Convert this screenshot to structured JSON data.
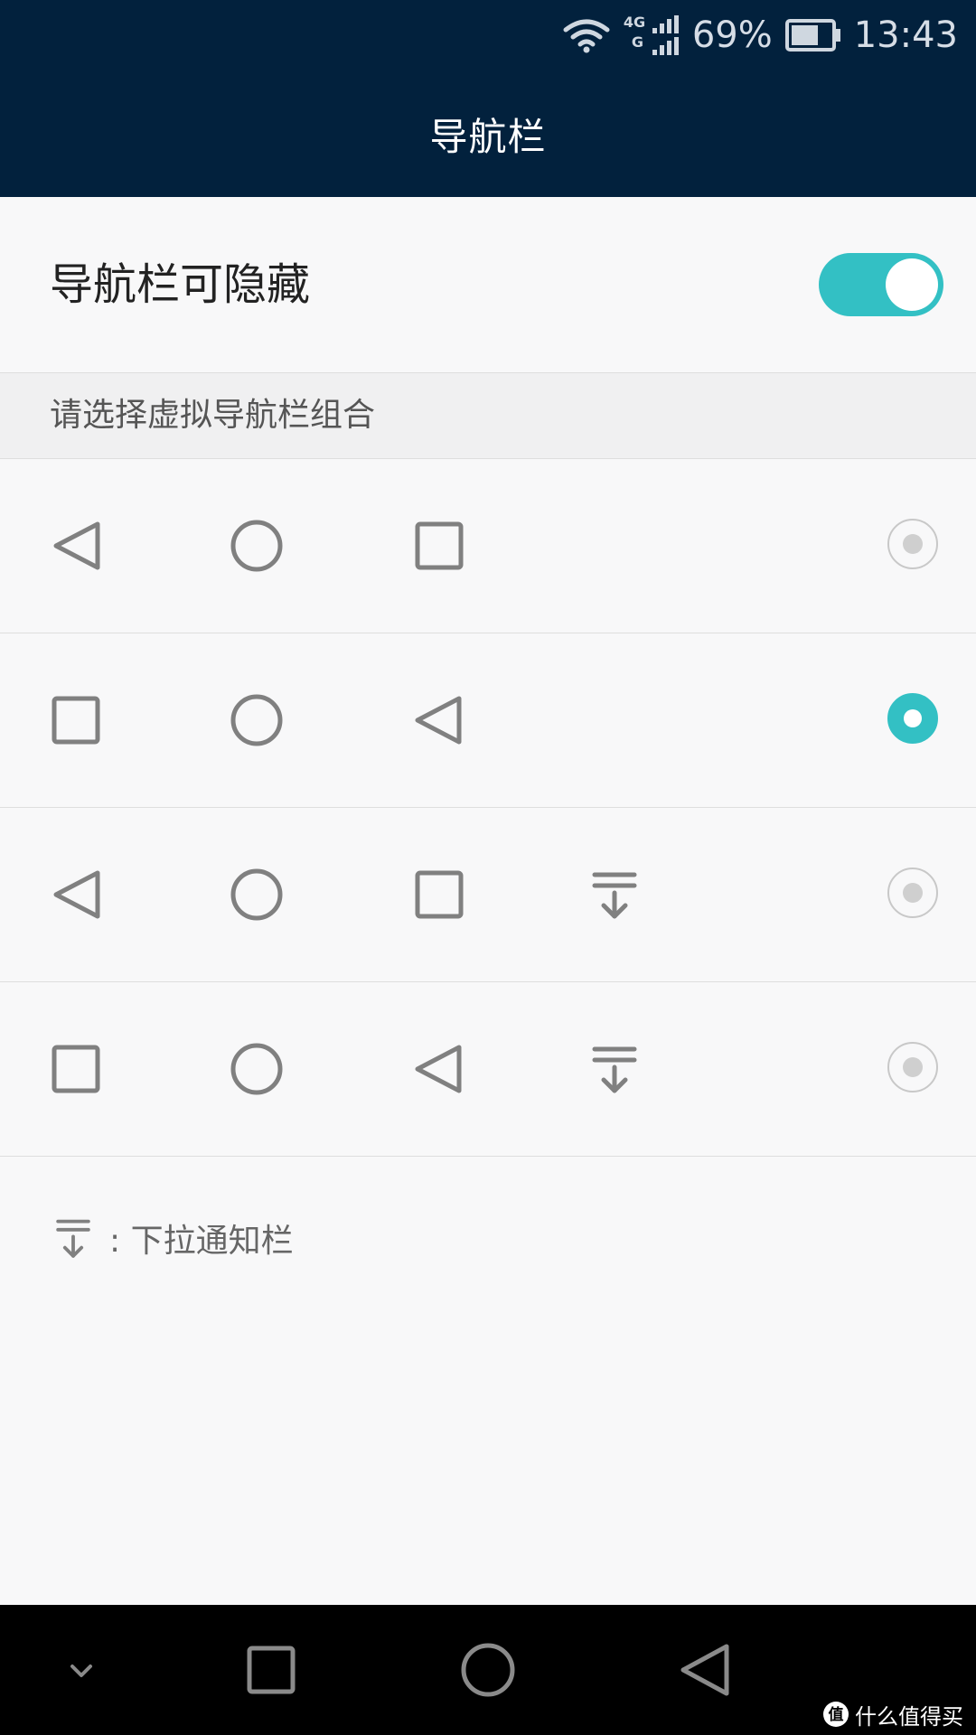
{
  "status_bar": {
    "network_label": "4G",
    "network_label_sub": "G",
    "battery_percent": "69%",
    "time": "13:43",
    "battery_level": 0.69
  },
  "header": {
    "title": "导航栏"
  },
  "hide_setting": {
    "label": "导航栏可隐藏",
    "enabled": true
  },
  "section": {
    "label": "请选择虚拟导航栏组合"
  },
  "options": [
    {
      "icons": [
        "back-triangle-icon",
        "home-circle-icon",
        "recent-square-icon"
      ],
      "selected": false
    },
    {
      "icons": [
        "recent-square-icon",
        "home-circle-icon",
        "back-triangle-icon"
      ],
      "selected": true
    },
    {
      "icons": [
        "back-triangle-icon",
        "home-circle-icon",
        "recent-square-icon",
        "notification-pulldown-icon"
      ],
      "selected": false
    },
    {
      "icons": [
        "recent-square-icon",
        "home-circle-icon",
        "back-triangle-icon",
        "notification-pulldown-icon"
      ],
      "selected": false
    }
  ],
  "legend": {
    "icon": "notification-pulldown-icon",
    "text": ": 下拉通知栏"
  },
  "system_nav": {
    "icons": [
      "hide-chevron-icon",
      "recent-square-icon",
      "home-circle-icon",
      "back-triangle-icon"
    ]
  },
  "watermark": {
    "text": "什么值得买"
  },
  "colors": {
    "accent": "#33c0c4",
    "header_bg": "#02213d",
    "icon_gray": "#808080"
  }
}
